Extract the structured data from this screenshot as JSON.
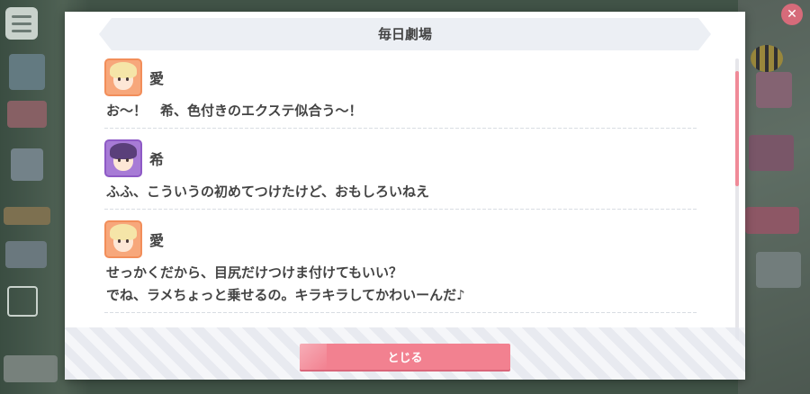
{
  "dialog": {
    "title": "毎日劇場",
    "close_label": "とじる"
  },
  "entries": [
    {
      "speaker": "愛",
      "avatar": "ai-portrait",
      "lines": [
        "お～！　希、色付きのエクステ似合う～！"
      ]
    },
    {
      "speaker": "希",
      "avatar": "nozomi-portrait",
      "lines": [
        "ふふ、こういうの初めてつけたけど、おもしろいねえ"
      ]
    },
    {
      "speaker": "愛",
      "avatar": "ai-portrait",
      "lines": [
        "せっかくだから、目尻だけつけま付けてもいい？",
        "でね、ラメちょっと乗せるの。キラキラしてかわいーんだ♪"
      ]
    }
  ],
  "colors": {
    "accent": "#f28190",
    "scroll_thumb": "#f08a98",
    "text": "#444444",
    "ai_frame": "#f7a77b",
    "nozomi_frame": "#a77bd6"
  },
  "icons": {
    "menu": "hamburger-icon",
    "close_corner": "close-icon",
    "expand": "expand-icon"
  }
}
